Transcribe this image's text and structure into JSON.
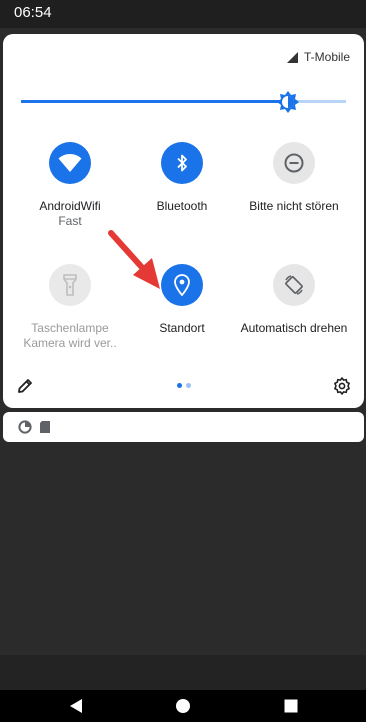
{
  "status_bar": {
    "time": "06:54"
  },
  "header": {
    "carrier": "T-Mobile"
  },
  "brightness": {
    "level": 0.82
  },
  "tiles": [
    {
      "label": "AndroidWifi",
      "sublabel": "Fast",
      "icon": "wifi-icon",
      "state": "on"
    },
    {
      "label": "Bluetooth",
      "sublabel": "",
      "icon": "bluetooth-icon",
      "state": "on"
    },
    {
      "label": "Bitte nicht stören",
      "sublabel": "",
      "icon": "do-not-disturb-icon",
      "state": "off"
    },
    {
      "label": "Taschenlampe",
      "sublabel": "Kamera wird ver..",
      "icon": "flashlight-icon",
      "state": "unavailable"
    },
    {
      "label": "Standort",
      "sublabel": "",
      "icon": "location-icon",
      "state": "on"
    },
    {
      "label": "Automatisch drehen",
      "sublabel": "",
      "icon": "auto-rotate-icon",
      "state": "off"
    }
  ],
  "page_indicator": {
    "current": 1,
    "total": 2
  },
  "notifications": {
    "icons": [
      "data-saver-icon",
      "sim-card-icon"
    ]
  },
  "colors": {
    "accent": "#1a73e8",
    "inactive": "#e6e6e6",
    "annotation_arrow": "#e53935"
  }
}
